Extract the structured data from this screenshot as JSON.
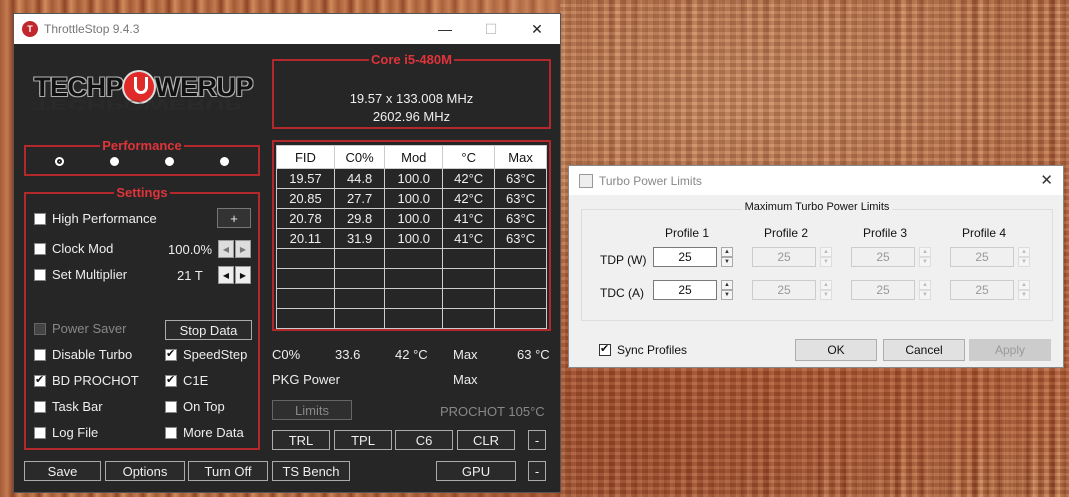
{
  "throttlestop": {
    "title": "ThrottleStop 9.4.3",
    "logo_pre": "TECHP",
    "logo_post": "WERUP",
    "cpu_name": "Core i5-480M",
    "multiplier_line": "19.57 x 133.008 MHz",
    "freq_line": "2602.96 MHz",
    "performance_label": "Performance",
    "settings_label": "Settings",
    "settings": {
      "high_performance": "High Performance",
      "plus": "+",
      "clock_mod": "Clock Mod",
      "clock_mod_value": "100.0%",
      "set_multiplier": "Set Multiplier",
      "set_multiplier_value": "21 T",
      "power_saver": "Power Saver",
      "stop_data": "Stop Data",
      "disable_turbo": "Disable Turbo",
      "speedstep": "SpeedStep",
      "bd_prochot": "BD PROCHOT",
      "c1e": "C1E",
      "task_bar": "Task Bar",
      "on_top": "On Top",
      "log_file": "Log File",
      "more_data": "More Data"
    },
    "table": {
      "headers": [
        "FID",
        "C0%",
        "Mod",
        "°C",
        "Max"
      ],
      "rows": [
        [
          "19.57",
          "44.8",
          "100.0",
          "42°C",
          "63°C"
        ],
        [
          "20.85",
          "27.7",
          "100.0",
          "42°C",
          "63°C"
        ],
        [
          "20.78",
          "29.8",
          "100.0",
          "41°C",
          "63°C"
        ],
        [
          "20.11",
          "31.9",
          "100.0",
          "41°C",
          "63°C"
        ]
      ]
    },
    "stats": {
      "c0_label": "C0%",
      "c0_value": "33.6",
      "temp": "42 °C",
      "max_label": "Max",
      "max_value": "63 °C",
      "pkg_label": "PKG Power",
      "pkg_max": "Max",
      "limits": "Limits",
      "prochot": "PROCHOT 105°C"
    },
    "buttons": {
      "trl": "TRL",
      "tpl": "TPL",
      "c6": "C6",
      "clr": "CLR",
      "minus": "-",
      "save": "Save",
      "options": "Options",
      "turn_off": "Turn Off",
      "ts_bench": "TS Bench",
      "gpu": "GPU"
    }
  },
  "turbo_dialog": {
    "title": "Turbo Power Limits",
    "group_title": "Maximum Turbo Power Limits",
    "profiles": [
      "Profile 1",
      "Profile 2",
      "Profile 3",
      "Profile 4"
    ],
    "tdp_label": "TDP (W)",
    "tdc_label": "TDC (A)",
    "tdp_values": [
      "25",
      "25",
      "25",
      "25"
    ],
    "tdc_values": [
      "25",
      "25",
      "25",
      "25"
    ],
    "sync_profiles": "Sync Profiles",
    "ok": "OK",
    "cancel": "Cancel",
    "apply": "Apply"
  },
  "colors": {
    "accent_red": "#b3282a",
    "window_bg": "#262626"
  }
}
